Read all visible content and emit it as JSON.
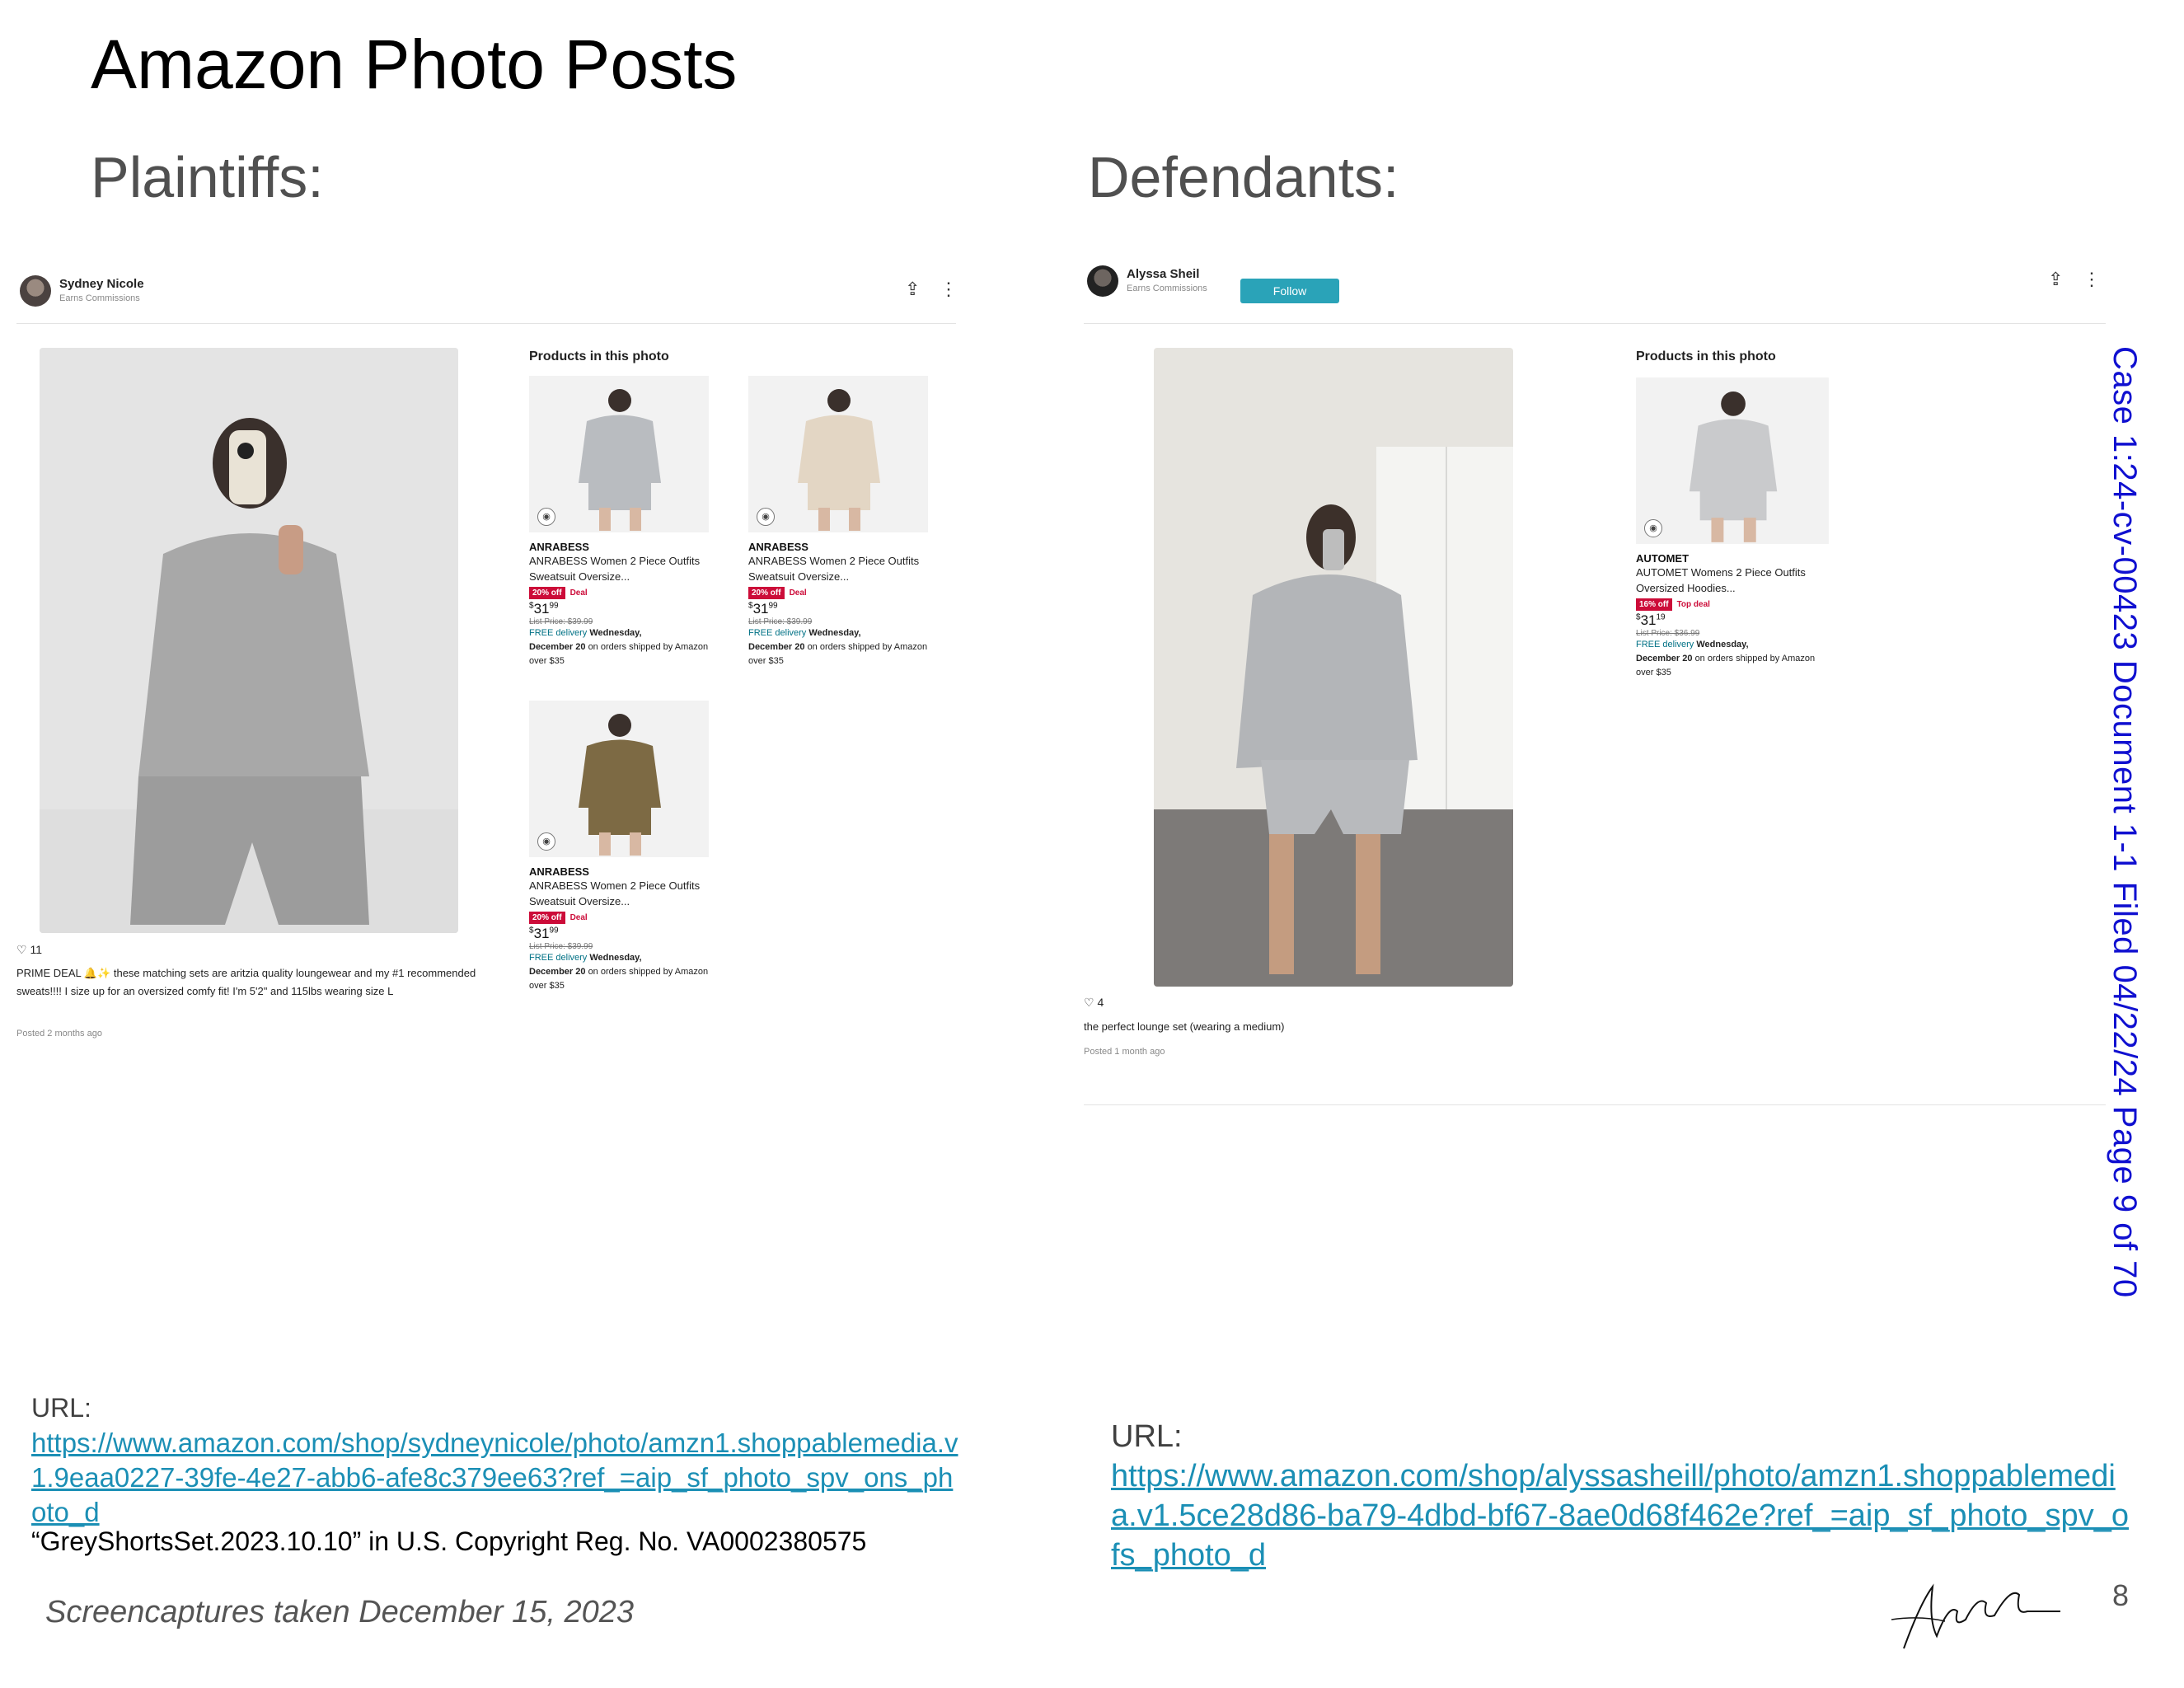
{
  "slide": {
    "title": "Amazon Photo Posts",
    "left_heading": "Plaintiffs:",
    "right_heading": "Defendants:",
    "page_number": "8",
    "capture_note": "Screencaptures taken December 15, 2023"
  },
  "case_stamp": "Case 1:24-cv-00423   Document 1-1   Filed 04/22/24   Page 9 of 70",
  "plaintiff_post": {
    "user_name": "Sydney Nicole",
    "user_subtitle": "Earns Commissions",
    "products_heading": "Products in this photo",
    "likes": "11",
    "caption": "PRIME DEAL 🔔✨ these matching sets are aritzia quality loungewear and my #1 recommended sweats!!!! I size up for an oversized comfy fit! I'm 5'2\" and 115lbs wearing size L",
    "posted": "Posted 2 months ago",
    "products": [
      {
        "brand": "ANRABESS",
        "name": "ANRABESS Women 2 Piece Outfits Sweatsuit Oversize...",
        "badge": "20% off",
        "deal": "Deal",
        "price_whole": "31",
        "price_cents": "99",
        "list_price": "List Price: $39.99",
        "free": "FREE delivery",
        "delivery_day": "Wednesday,",
        "delivery_date": "December 20",
        "delivery_rest": "on orders shipped by Amazon over $35",
        "garment_color": "#b9bcc0"
      },
      {
        "brand": "ANRABESS",
        "name": "ANRABESS Women 2 Piece Outfits Sweatsuit Oversize...",
        "badge": "20% off",
        "deal": "Deal",
        "price_whole": "31",
        "price_cents": "99",
        "list_price": "List Price: $39.99",
        "free": "FREE delivery",
        "delivery_day": "Wednesday,",
        "delivery_date": "December 20",
        "delivery_rest": "on orders shipped by Amazon over $35",
        "garment_color": "#e3d6c4"
      },
      {
        "brand": "ANRABESS",
        "name": "ANRABESS Women 2 Piece Outfits Sweatsuit Oversize...",
        "badge": "20% off",
        "deal": "Deal",
        "price_whole": "31",
        "price_cents": "99",
        "list_price": "List Price: $39.99",
        "free": "FREE delivery",
        "delivery_day": "Wednesday,",
        "delivery_date": "December 20",
        "delivery_rest": "on orders shipped by Amazon over $35",
        "garment_color": "#7d6a44"
      }
    ],
    "url_label": "URL:",
    "url": "https://www.amazon.com/shop/sydneynicole/photo/amzn1.shoppablemedia.v1.9eaa0227-39fe-4e27-abb6-afe8c379ee63?ref_=aip_sf_photo_spv_ons_photo_d",
    "copyright": "“GreyShortsSet.2023.10.10” in U.S. Copyright Reg. No. VA0002380575"
  },
  "defendant_post": {
    "user_name": "Alyssa Sheil",
    "user_subtitle": "Earns Commissions",
    "follow_label": "Follow",
    "products_heading": "Products in this photo",
    "likes": "4",
    "caption": "the perfect lounge set (wearing a medium)",
    "posted": "Posted 1 month ago",
    "products": [
      {
        "brand": "AUTOMET",
        "name": "AUTOMET Womens 2 Piece Outfits Oversized Hoodies...",
        "badge": "16% off",
        "deal": "Top deal",
        "price_whole": "31",
        "price_cents": "19",
        "list_price": "List Price: $36.99",
        "free": "FREE delivery",
        "delivery_day": "Wednesday,",
        "delivery_date": "December 20",
        "delivery_rest": "on orders shipped by Amazon over $35",
        "garment_color": "#c9cacc"
      }
    ],
    "url_label": "URL:",
    "url": "https://www.amazon.com/shop/alyssasheill/photo/amzn1.shoppablemedia.v1.5ce28d86-ba79-4dbd-bf67-8ae0d68f462e?ref_=aip_sf_photo_spv_ofs_photo_d"
  },
  "colors": {
    "link": "#1b8fb5",
    "stamp": "#1010d0",
    "deal_red": "#cc0c39",
    "follow": "#2aa3b8"
  }
}
